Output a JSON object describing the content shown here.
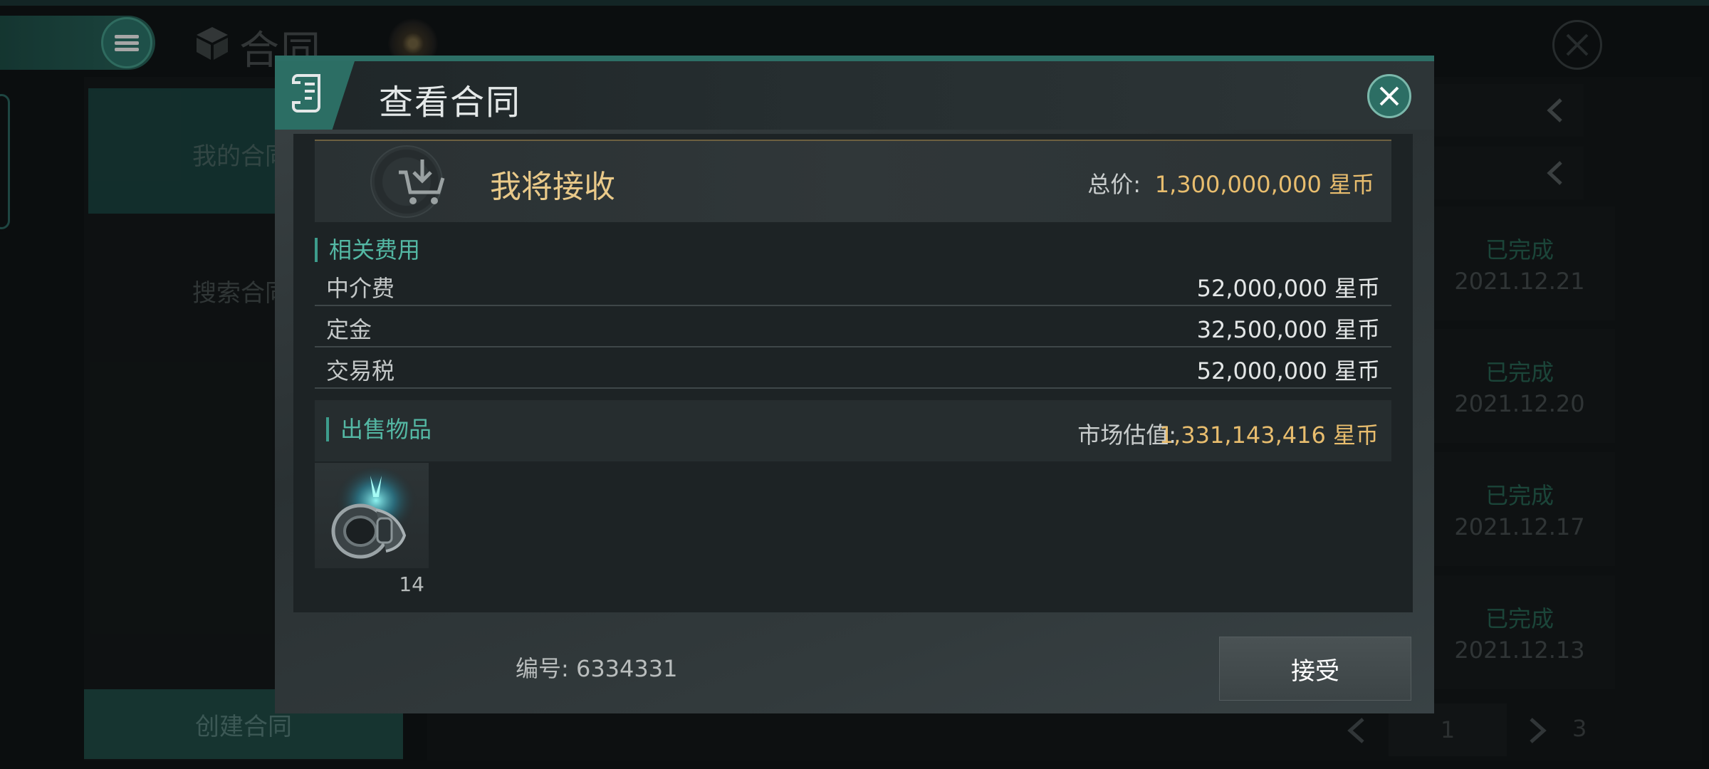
{
  "background": {
    "app_title": "合同",
    "sidebar": {
      "my_contracts": "我的合同",
      "search_contracts": "搜索合同",
      "create_contract": "创建合同"
    },
    "list": [
      {
        "status": "已完成",
        "date": "2021.12.21"
      },
      {
        "status": "已完成",
        "date": "2021.12.20"
      },
      {
        "status": "已完成",
        "date": "2021.12.17"
      },
      {
        "status": "已完成",
        "date": "2021.12.13"
      }
    ],
    "pager": {
      "current": "1",
      "total": "3"
    }
  },
  "dialog": {
    "title": "查看合同",
    "receive": {
      "label": "我将接收",
      "total_label": "总价:",
      "total_value": "1,300,000,000 星币"
    },
    "fees": {
      "heading": "相关费用",
      "rows": [
        {
          "name": "中介费",
          "value": "52,000,000 星币"
        },
        {
          "name": "定金",
          "value": "32,500,000 星币"
        },
        {
          "name": "交易税",
          "value": "52,000,000 星币"
        }
      ]
    },
    "sale": {
      "heading": "出售物品",
      "market_label": "市场估值:",
      "market_value": "1,331,143,416 星币",
      "items": [
        {
          "icon": "engine-module-icon",
          "count": "14"
        }
      ]
    },
    "contract_number": "编号: 6334331",
    "accept_label": "接受"
  },
  "colors": {
    "accent_teal": "#2c6e64",
    "gold": "#e8bd6e",
    "status_green": "#2a6a58"
  }
}
